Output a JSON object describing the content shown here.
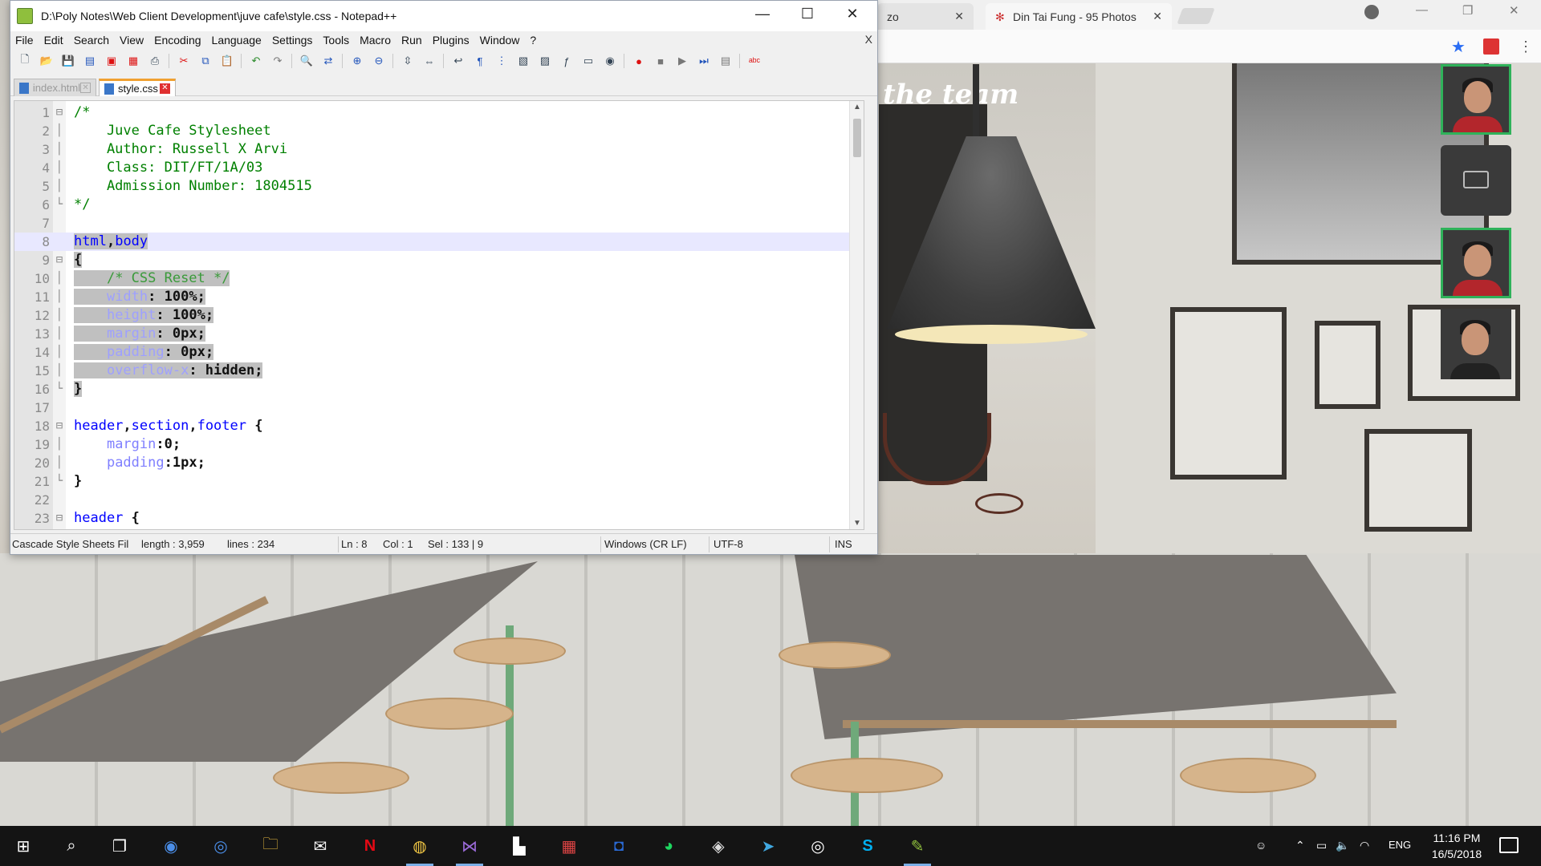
{
  "notepad": {
    "title": "D:\\Poly Notes\\Web Client Development\\juve cafe\\style.css - Notepad++",
    "menu": [
      "File",
      "Edit",
      "Search",
      "View",
      "Encoding",
      "Language",
      "Settings",
      "Tools",
      "Macro",
      "Run",
      "Plugins",
      "Window",
      "?"
    ],
    "close_doc": "X",
    "tabs": [
      {
        "label": "index.html",
        "active": false
      },
      {
        "label": "style.css",
        "active": true
      }
    ],
    "code": [
      {
        "ln": "1",
        "fold": "⊟",
        "parts": [
          [
            "c-com",
            "/*"
          ]
        ]
      },
      {
        "ln": "2",
        "fold": "│",
        "parts": [
          [
            "c-com",
            "    Juve Cafe Stylesheet"
          ]
        ]
      },
      {
        "ln": "3",
        "fold": "│",
        "parts": [
          [
            "c-com",
            "    Author: Russell X Arvi"
          ]
        ]
      },
      {
        "ln": "4",
        "fold": "│",
        "parts": [
          [
            "c-com",
            "    Class: DIT/FT/1A/03"
          ]
        ]
      },
      {
        "ln": "5",
        "fold": "│",
        "parts": [
          [
            "c-com",
            "    Admission Number: 1804515"
          ]
        ]
      },
      {
        "ln": "6",
        "fold": "└",
        "parts": [
          [
            "c-com",
            "*/"
          ]
        ]
      },
      {
        "ln": "7",
        "fold": "",
        "parts": []
      },
      {
        "ln": "8",
        "fold": "",
        "current": true,
        "parts": [
          [
            "c-sel hl",
            "html"
          ],
          [
            "c-op hl",
            ","
          ],
          [
            "c-sel hl",
            "body"
          ]
        ]
      },
      {
        "ln": "9",
        "fold": "⊟",
        "parts": [
          [
            "c-op hl",
            "{"
          ]
        ]
      },
      {
        "ln": "10",
        "fold": "│",
        "parts": [
          [
            "hl",
            "    "
          ],
          [
            "c-hlcom hl",
            "/* CSS Reset */"
          ]
        ]
      },
      {
        "ln": "11",
        "fold": "│",
        "parts": [
          [
            "hl",
            "    "
          ],
          [
            "c-hlprop hl",
            "width"
          ],
          [
            "c-op hl",
            ": "
          ],
          [
            "c-val hl",
            "100%"
          ],
          [
            "c-op hl",
            ";"
          ]
        ]
      },
      {
        "ln": "12",
        "fold": "│",
        "parts": [
          [
            "hl",
            "    "
          ],
          [
            "c-hlprop hl",
            "height"
          ],
          [
            "c-op hl",
            ": "
          ],
          [
            "c-val hl",
            "100%"
          ],
          [
            "c-op hl",
            ";"
          ]
        ]
      },
      {
        "ln": "13",
        "fold": "│",
        "parts": [
          [
            "hl",
            "    "
          ],
          [
            "c-hlprop hl",
            "margin"
          ],
          [
            "c-op hl",
            ": "
          ],
          [
            "c-val hl",
            "0px"
          ],
          [
            "c-op hl",
            ";"
          ]
        ]
      },
      {
        "ln": "14",
        "fold": "│",
        "parts": [
          [
            "hl",
            "    "
          ],
          [
            "c-hlprop hl",
            "padding"
          ],
          [
            "c-op hl",
            ": "
          ],
          [
            "c-val hl",
            "0px"
          ],
          [
            "c-op hl",
            ";"
          ]
        ]
      },
      {
        "ln": "15",
        "fold": "│",
        "parts": [
          [
            "hl",
            "    "
          ],
          [
            "c-hlprop hl",
            "overflow-x"
          ],
          [
            "c-op hl",
            ": "
          ],
          [
            "c-val hl",
            "hidden"
          ],
          [
            "c-op hl",
            ";"
          ]
        ]
      },
      {
        "ln": "16",
        "fold": "└",
        "parts": [
          [
            "c-op hl",
            "}"
          ]
        ]
      },
      {
        "ln": "17",
        "fold": "",
        "parts": []
      },
      {
        "ln": "18",
        "fold": "⊟",
        "parts": [
          [
            "c-sel",
            "header"
          ],
          [
            "c-op",
            ","
          ],
          [
            "c-sel",
            "section"
          ],
          [
            "c-op",
            ","
          ],
          [
            "c-sel",
            "footer"
          ],
          [
            "c-op",
            " {"
          ]
        ]
      },
      {
        "ln": "19",
        "fold": "│",
        "parts": [
          [
            "",
            "    "
          ],
          [
            "c-prop",
            "margin"
          ],
          [
            "c-op",
            ":"
          ],
          [
            "c-val",
            "0"
          ],
          [
            "c-op",
            ";"
          ]
        ]
      },
      {
        "ln": "20",
        "fold": "│",
        "parts": [
          [
            "",
            "    "
          ],
          [
            "c-prop",
            "padding"
          ],
          [
            "c-op",
            ":"
          ],
          [
            "c-val",
            "1px"
          ],
          [
            "c-op",
            ";"
          ]
        ]
      },
      {
        "ln": "21",
        "fold": "└",
        "parts": [
          [
            "c-op",
            "}"
          ]
        ]
      },
      {
        "ln": "22",
        "fold": "",
        "parts": []
      },
      {
        "ln": "23",
        "fold": "⊟",
        "parts": [
          [
            "c-sel",
            "header"
          ],
          [
            "c-op",
            " {"
          ]
        ]
      }
    ],
    "status": {
      "type": "Cascade Style Sheets Fil",
      "length": "length : 3,959",
      "lines": "lines : 234",
      "ln": "Ln : 8",
      "col": "Col : 1",
      "sel": "Sel : 133 | 9",
      "eol": "Windows (CR LF)",
      "encoding": "UTF-8",
      "mode": "INS"
    }
  },
  "chrome": {
    "tab1_label": "zo",
    "tab2_label": "Din Tai Fung - 95 Photos",
    "tab_close": "✕"
  },
  "background": {
    "team_text": "the team"
  },
  "taskbar": {
    "lang": "ENG",
    "time": "11:16 PM",
    "date": "16/5/2018"
  }
}
